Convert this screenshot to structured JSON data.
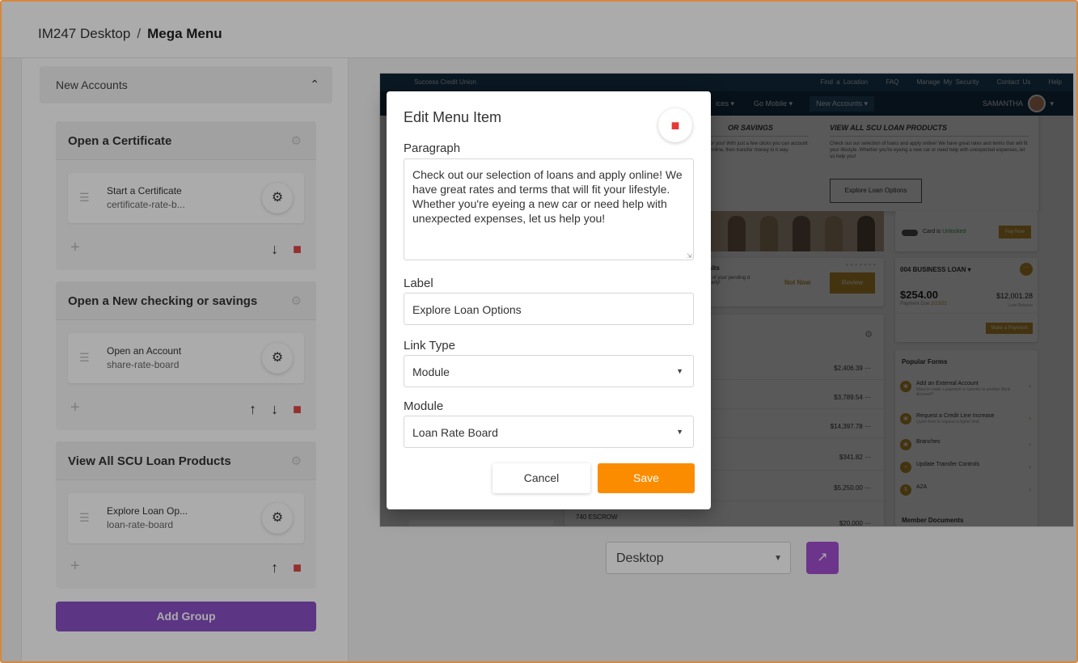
{
  "breadcrumb": {
    "root": "IM247 Desktop",
    "separator": "/",
    "current": "Mega Menu"
  },
  "accordion": {
    "label": "New Accounts",
    "chevron": "chevron-up-icon"
  },
  "groups": [
    {
      "title": "Open a Certificate",
      "item_title": "Start a Certificate",
      "item_sub": "certificate-rate-b..."
    },
    {
      "title": "Open a New checking or savings",
      "item_title": "Open an Account",
      "item_sub": "share-rate-board"
    },
    {
      "title": "View All SCU Loan Products",
      "item_title": "Explore Loan Op...",
      "item_sub": "loan-rate-board"
    }
  ],
  "add_group_label": "Add Group",
  "preview": {
    "credit_union": "Success Credit Union",
    "top_links": [
      "Find a Location",
      "FAQ",
      "Manage My Security",
      "Contact Us",
      "Help"
    ],
    "nav": [
      "ices",
      "Go Mobile",
      "New Accounts"
    ],
    "user": "SAMANTHA",
    "mega_heading_1": "OR SAVINGS",
    "mega_heading_2": "VIEW ALL SCU LOAN PRODUCTS",
    "mega_text_1": "or you! With just a few clicks you can account online, then transfer money to it way.",
    "mega_text_2": "Check out our selection of loans and apply online! We have great rates and terms that will fit your lifestyle. Whether you're eyeing a new car or need help with unexpected expenses, let us help you!",
    "mega_button": "Explore Loan Options",
    "card_status_prefix": "Card is",
    "card_status": "Unlocked",
    "pay_now": "Pay Now",
    "visits_title": "sits",
    "visits_sub": "s of your pending d early!",
    "not_now": "Not Now",
    "review": "Review",
    "loan_title": "004 BUSINESS LOAN",
    "loan_amount": "$254.00",
    "loan_balance": "$12,001.28",
    "payment_due_label": "Payment Due",
    "payment_due_date": "2/13/21",
    "loan_balance_label": "Loan Balance",
    "make_payment": "Make a Payment",
    "account_values": [
      "$2,406.39",
      "$3,789.54",
      "$14,397.78",
      "$341.82",
      "$5,250.00",
      "$20,000"
    ],
    "escrow": "740 ESCROW",
    "popular_forms_title": "Popular Forms",
    "forms": [
      {
        "title": "Add an External Account",
        "sub": "Want to make a payment or transfer to another Bank Account?"
      },
      {
        "title": "Request a Credit Line Increase",
        "sub": "Quick form to request a higher limit."
      },
      {
        "title": "Branches",
        "sub": ""
      },
      {
        "title": "Update Transfer Controls",
        "sub": ""
      },
      {
        "title": "A2A",
        "sub": ""
      }
    ],
    "member_documents": "Member Documents"
  },
  "device_select": {
    "value": "Desktop"
  },
  "modal": {
    "title": "Edit Menu Item",
    "paragraph_label": "Paragraph",
    "paragraph_value": "Check out our selection of loans and apply online! We have great rates and terms that will fit your lifestyle. Whether you're eyeing a new car or need help with unexpected expenses, let us help you!",
    "label_label": "Label",
    "label_value": "Explore Loan Options",
    "link_type_label": "Link Type",
    "link_type_value": "Module",
    "module_label": "Module",
    "module_value": "Loan Rate Board",
    "cancel_label": "Cancel",
    "save_label": "Save"
  },
  "colors": {
    "accent_orange": "#fb8c00",
    "purple": "#8a4fc7",
    "trash_red": "#e53935",
    "gold": "#c2922c",
    "navy": "#1f4866"
  }
}
